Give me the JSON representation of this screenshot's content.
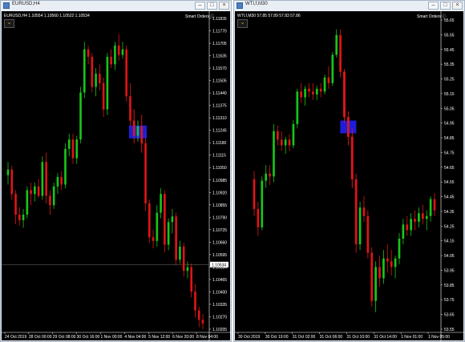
{
  "left": {
    "window_title": "EURUSD,H4",
    "header": "EURUSD,H4  1.10554 1.10560 1.10522 1.10534",
    "smart_orders": "Smart Orders",
    "menu_glyph": "⌄",
    "price_labels": [
      "1.11835",
      "1.11770",
      "1.11705",
      "1.11635",
      "1.11570",
      "1.11505",
      "1.11440",
      "1.11375",
      "1.11310",
      "1.11245",
      "1.11180",
      "1.11115",
      "1.11050",
      "1.10985",
      "1.10920",
      "1.10855",
      "1.10790",
      "1.10725",
      "1.10660",
      "1.10595",
      "1.10534",
      "1.10465",
      "1.10400",
      "1.10335",
      "1.10270",
      "1.10205"
    ],
    "current_price": "1.10534",
    "time_labels": [
      "24 Oct 2019",
      "28 Oct 00:00",
      "29 Oct 08:00",
      "30 Oct 16:00",
      "1 Nov 00:00",
      "4 Nov 04:00",
      "5 Nov 12:00",
      "6 Nov 20:00",
      "8 Nov 04:00"
    ],
    "chart_data": {
      "type": "candlestick",
      "symbol": "EURUSD",
      "timeframe": "H4",
      "ylim": [
        1.1019,
        1.1187
      ],
      "candles": [
        {
          "o": 1.1101,
          "h": 1.1108,
          "l": 1.1096,
          "c": 1.1104
        },
        {
          "o": 1.1104,
          "h": 1.1106,
          "l": 1.1088,
          "c": 1.1091
        },
        {
          "o": 1.1091,
          "h": 1.1093,
          "l": 1.1075,
          "c": 1.108
        },
        {
          "o": 1.108,
          "h": 1.1084,
          "l": 1.1074,
          "c": 1.1077
        },
        {
          "o": 1.1077,
          "h": 1.1083,
          "l": 1.1073,
          "c": 1.108
        },
        {
          "o": 1.108,
          "h": 1.1095,
          "l": 1.1078,
          "c": 1.1093
        },
        {
          "o": 1.1093,
          "h": 1.1097,
          "l": 1.1085,
          "c": 1.1091
        },
        {
          "o": 1.1091,
          "h": 1.1097,
          "l": 1.1087,
          "c": 1.1095
        },
        {
          "o": 1.1095,
          "h": 1.1099,
          "l": 1.1089,
          "c": 1.109
        },
        {
          "o": 1.109,
          "h": 1.1111,
          "l": 1.1088,
          "c": 1.1108
        },
        {
          "o": 1.1108,
          "h": 1.1113,
          "l": 1.1086,
          "c": 1.109
        },
        {
          "o": 1.109,
          "h": 1.1093,
          "l": 1.108,
          "c": 1.1085
        },
        {
          "o": 1.1085,
          "h": 1.1097,
          "l": 1.1083,
          "c": 1.1095
        },
        {
          "o": 1.1095,
          "h": 1.1102,
          "l": 1.1091,
          "c": 1.11
        },
        {
          "o": 1.11,
          "h": 1.1103,
          "l": 1.1093,
          "c": 1.1096
        },
        {
          "o": 1.1096,
          "h": 1.1118,
          "l": 1.1094,
          "c": 1.1115
        },
        {
          "o": 1.1115,
          "h": 1.1123,
          "l": 1.1111,
          "c": 1.112
        },
        {
          "o": 1.112,
          "h": 1.1123,
          "l": 1.1107,
          "c": 1.111
        },
        {
          "o": 1.111,
          "h": 1.1122,
          "l": 1.1107,
          "c": 1.112
        },
        {
          "o": 1.112,
          "h": 1.1148,
          "l": 1.1118,
          "c": 1.1145
        },
        {
          "o": 1.1145,
          "h": 1.1172,
          "l": 1.1142,
          "c": 1.1168
        },
        {
          "o": 1.1168,
          "h": 1.117,
          "l": 1.116,
          "c": 1.1164
        },
        {
          "o": 1.1164,
          "h": 1.1166,
          "l": 1.1145,
          "c": 1.1148
        },
        {
          "o": 1.1148,
          "h": 1.1158,
          "l": 1.1143,
          "c": 1.1155
        },
        {
          "o": 1.1155,
          "h": 1.116,
          "l": 1.1146,
          "c": 1.115
        },
        {
          "o": 1.115,
          "h": 1.1153,
          "l": 1.1132,
          "c": 1.1136
        },
        {
          "o": 1.1136,
          "h": 1.1166,
          "l": 1.1133,
          "c": 1.1164
        },
        {
          "o": 1.1164,
          "h": 1.1168,
          "l": 1.1158,
          "c": 1.116
        },
        {
          "o": 1.116,
          "h": 1.1172,
          "l": 1.1157,
          "c": 1.117
        },
        {
          "o": 1.117,
          "h": 1.1176,
          "l": 1.1162,
          "c": 1.1165
        },
        {
          "o": 1.1165,
          "h": 1.1172,
          "l": 1.1163,
          "c": 1.1168
        },
        {
          "o": 1.1168,
          "h": 1.117,
          "l": 1.114,
          "c": 1.1143
        },
        {
          "o": 1.1143,
          "h": 1.115,
          "l": 1.1126,
          "c": 1.113
        },
        {
          "o": 1.113,
          "h": 1.1136,
          "l": 1.1118,
          "c": 1.1122
        },
        {
          "o": 1.1122,
          "h": 1.113,
          "l": 1.1119,
          "c": 1.1127
        },
        {
          "o": 1.1127,
          "h": 1.1133,
          "l": 1.1113,
          "c": 1.1118
        },
        {
          "o": 1.1118,
          "h": 1.1124,
          "l": 1.1082,
          "c": 1.1086
        },
        {
          "o": 1.1086,
          "h": 1.1088,
          "l": 1.1065,
          "c": 1.1068
        },
        {
          "o": 1.1068,
          "h": 1.1072,
          "l": 1.1062,
          "c": 1.1066
        },
        {
          "o": 1.1066,
          "h": 1.1085,
          "l": 1.1063,
          "c": 1.1081
        },
        {
          "o": 1.1081,
          "h": 1.1094,
          "l": 1.1078,
          "c": 1.1091
        },
        {
          "o": 1.1091,
          "h": 1.1093,
          "l": 1.106,
          "c": 1.1064
        },
        {
          "o": 1.1064,
          "h": 1.1078,
          "l": 1.1061,
          "c": 1.1076
        },
        {
          "o": 1.1076,
          "h": 1.1083,
          "l": 1.107,
          "c": 1.1079
        },
        {
          "o": 1.1079,
          "h": 1.1081,
          "l": 1.1053,
          "c": 1.1056
        },
        {
          "o": 1.1056,
          "h": 1.1066,
          "l": 1.1054,
          "c": 1.1063
        },
        {
          "o": 1.1063,
          "h": 1.1065,
          "l": 1.1047,
          "c": 1.105
        },
        {
          "o": 1.105,
          "h": 1.1055,
          "l": 1.1046,
          "c": 1.1052
        },
        {
          "o": 1.1052,
          "h": 1.1054,
          "l": 1.1036,
          "c": 1.1039
        },
        {
          "o": 1.1039,
          "h": 1.1043,
          "l": 1.1025,
          "c": 1.1029
        },
        {
          "o": 1.1029,
          "h": 1.1031,
          "l": 1.102,
          "c": 1.1024
        },
        {
          "o": 1.1024,
          "h": 1.1027,
          "l": 1.1019,
          "c": 1.1022
        }
      ]
    }
  },
  "right": {
    "window_title": "WTI,f,M30",
    "header": "WTI,f,M30  57.85 57.89 57.83 57.86",
    "smart_orders": "Smart Orders",
    "menu_glyph": "⌄",
    "price_labels": [
      "55.65",
      "55.55",
      "55.45",
      "55.35",
      "55.25",
      "55.15",
      "55.05",
      "54.95",
      "54.85",
      "54.75",
      "54.65",
      "54.55",
      "54.45",
      "54.35",
      "54.25",
      "54.15",
      "54.05",
      "53.95",
      "53.85",
      "53.75",
      "53.65",
      "53.55"
    ],
    "time_labels": [
      "30 Oct 2019",
      "30 Oct 19:00",
      "31 Oct 02:00",
      "31 Oct 06:00",
      "31 Oct 10:00",
      "31 Oct 14:00",
      "1 Nov 01:00",
      "1 Nov 05:00"
    ],
    "chart_data": {
      "type": "candlestick",
      "symbol": "WTI,f",
      "timeframe": "M30",
      "ylim": [
        53.5,
        55.72
      ],
      "candles": [
        {
          "o": 54.56,
          "h": 54.62,
          "l": 54.3,
          "c": 54.35
        },
        {
          "o": 54.35,
          "h": 54.4,
          "l": 54.16,
          "c": 54.22
        },
        {
          "o": 54.22,
          "h": 54.58,
          "l": 54.2,
          "c": 54.55
        },
        {
          "o": 54.55,
          "h": 54.66,
          "l": 54.5,
          "c": 54.6
        },
        {
          "o": 54.6,
          "h": 54.66,
          "l": 54.52,
          "c": 54.58
        },
        {
          "o": 54.58,
          "h": 54.95,
          "l": 54.54,
          "c": 54.9
        },
        {
          "o": 54.9,
          "h": 54.94,
          "l": 54.8,
          "c": 54.84
        },
        {
          "o": 54.84,
          "h": 54.9,
          "l": 54.76,
          "c": 54.8
        },
        {
          "o": 54.8,
          "h": 54.86,
          "l": 54.74,
          "c": 54.84
        },
        {
          "o": 54.84,
          "h": 54.88,
          "l": 54.76,
          "c": 54.8
        },
        {
          "o": 54.8,
          "h": 54.98,
          "l": 54.78,
          "c": 54.95
        },
        {
          "o": 54.95,
          "h": 55.2,
          "l": 54.92,
          "c": 55.18
        },
        {
          "o": 55.18,
          "h": 55.24,
          "l": 55.1,
          "c": 55.14
        },
        {
          "o": 55.14,
          "h": 55.22,
          "l": 55.08,
          "c": 55.2
        },
        {
          "o": 55.2,
          "h": 55.24,
          "l": 55.14,
          "c": 55.18
        },
        {
          "o": 55.18,
          "h": 55.24,
          "l": 55.12,
          "c": 55.16
        },
        {
          "o": 55.16,
          "h": 55.22,
          "l": 55.12,
          "c": 55.2
        },
        {
          "o": 55.2,
          "h": 55.24,
          "l": 55.14,
          "c": 55.18
        },
        {
          "o": 55.18,
          "h": 55.3,
          "l": 55.16,
          "c": 55.28
        },
        {
          "o": 55.28,
          "h": 55.36,
          "l": 55.2,
          "c": 55.24
        },
        {
          "o": 55.24,
          "h": 55.46,
          "l": 55.22,
          "c": 55.44
        },
        {
          "o": 55.44,
          "h": 55.62,
          "l": 55.42,
          "c": 55.58
        },
        {
          "o": 55.58,
          "h": 55.62,
          "l": 55.28,
          "c": 55.32
        },
        {
          "o": 55.32,
          "h": 55.34,
          "l": 54.96,
          "c": 55.0
        },
        {
          "o": 55.0,
          "h": 55.04,
          "l": 54.8,
          "c": 54.86
        },
        {
          "o": 54.86,
          "h": 54.92,
          "l": 54.5,
          "c": 54.56
        },
        {
          "o": 54.56,
          "h": 54.6,
          "l": 54.04,
          "c": 54.1
        },
        {
          "o": 54.1,
          "h": 54.4,
          "l": 54.06,
          "c": 54.36
        },
        {
          "o": 54.36,
          "h": 54.44,
          "l": 54.26,
          "c": 54.3
        },
        {
          "o": 54.3,
          "h": 54.34,
          "l": 54.0,
          "c": 54.04
        },
        {
          "o": 54.04,
          "h": 54.08,
          "l": 53.66,
          "c": 53.7
        },
        {
          "o": 53.7,
          "h": 53.98,
          "l": 53.62,
          "c": 53.94
        },
        {
          "o": 53.94,
          "h": 54.02,
          "l": 53.8,
          "c": 53.86
        },
        {
          "o": 53.86,
          "h": 54.06,
          "l": 53.82,
          "c": 54.0
        },
        {
          "o": 54.0,
          "h": 54.1,
          "l": 53.9,
          "c": 53.98
        },
        {
          "o": 53.98,
          "h": 54.06,
          "l": 53.88,
          "c": 53.94
        },
        {
          "o": 53.94,
          "h": 54.02,
          "l": 53.86,
          "c": 54.0
        },
        {
          "o": 54.0,
          "h": 54.18,
          "l": 53.96,
          "c": 54.14
        },
        {
          "o": 54.14,
          "h": 54.28,
          "l": 54.1,
          "c": 54.24
        },
        {
          "o": 54.24,
          "h": 54.3,
          "l": 54.16,
          "c": 54.2
        },
        {
          "o": 54.2,
          "h": 54.32,
          "l": 54.16,
          "c": 54.28
        },
        {
          "o": 54.28,
          "h": 54.34,
          "l": 54.2,
          "c": 54.26
        },
        {
          "o": 54.26,
          "h": 54.36,
          "l": 54.22,
          "c": 54.32
        },
        {
          "o": 54.32,
          "h": 54.38,
          "l": 54.24,
          "c": 54.28
        },
        {
          "o": 54.28,
          "h": 54.34,
          "l": 54.2,
          "c": 54.3
        },
        {
          "o": 54.3,
          "h": 54.44,
          "l": 54.26,
          "c": 54.42
        },
        {
          "o": 54.42,
          "h": 54.46,
          "l": 54.3,
          "c": 54.34
        }
      ]
    }
  },
  "colors": {
    "bull": "#19c519",
    "bear": "#e01515",
    "grid_line": "#5a5a5a",
    "highlight": "#2222ff",
    "background": "#000000"
  }
}
